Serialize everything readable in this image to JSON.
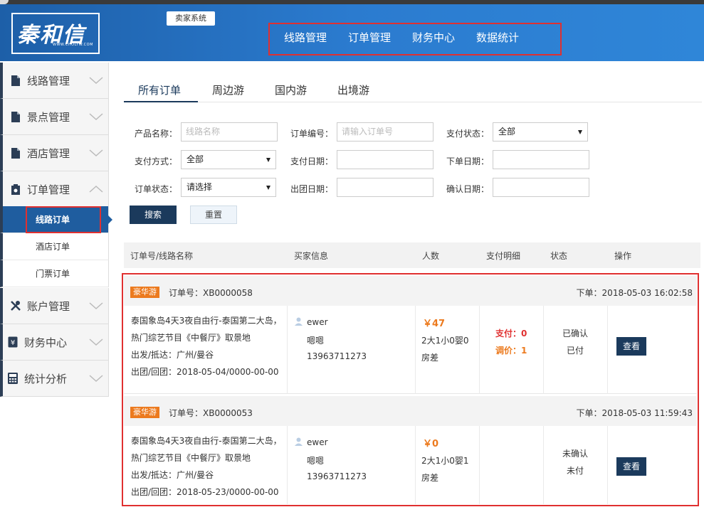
{
  "app": {
    "logo_text": "秦和信",
    "logo_url": "WWW.CHOLYW.COM",
    "system_label": "卖家系统"
  },
  "top_nav": [
    "线路管理",
    "订单管理",
    "财务中心",
    "数据统计"
  ],
  "sidebar": {
    "items": [
      {
        "label": "线路管理",
        "icon": "document-icon"
      },
      {
        "label": "景点管理",
        "icon": "document-icon"
      },
      {
        "label": "酒店管理",
        "icon": "document-icon"
      },
      {
        "label": "订单管理",
        "icon": "order-icon"
      },
      {
        "label": "账户管理",
        "icon": "tools-icon"
      },
      {
        "label": "财务中心",
        "icon": "yen-icon"
      },
      {
        "label": "统计分析",
        "icon": "calculator-icon"
      }
    ],
    "sub_items": [
      "线路订单",
      "酒店订单",
      "门票订单"
    ]
  },
  "tabs": [
    "所有订单",
    "周边游",
    "国内游",
    "出境游"
  ],
  "filters": {
    "product_name_label": "产品名称：",
    "product_name_placeholder": "线路名称",
    "order_no_label": "订单编号：",
    "order_no_placeholder": "请输入订单号",
    "pay_status_label": "支付状态：",
    "pay_status_value": "全部",
    "pay_method_label": "支付方式：",
    "pay_method_value": "全部",
    "pay_date_label": "支付日期：",
    "order_date_label": "下单日期：",
    "order_status_label": "订单状态：",
    "order_status_value": "请选择",
    "depart_date_label": "出团日期：",
    "confirm_date_label": "确认日期：",
    "search_label": "搜索",
    "reset_label": "重置"
  },
  "list_header": [
    "订单号/线路名称",
    "买家信息",
    "人数",
    "支付明细",
    "状态",
    "操作"
  ],
  "orders": [
    {
      "tag": "豪华游",
      "order_no": "订单号：XB0000058",
      "time": "下单：2018-05-03 16:02:58",
      "route_line1": "泰国象岛4天3夜自由行-泰国第二大岛，",
      "route_line2": "热门综艺节目《中餐厅》取景地",
      "route_line3": "出发/抵达：广州/曼谷",
      "route_line4": "出团/回团：2018-05-04/0000-00-00",
      "buyer_name": "ewer",
      "buyer_nick": "嗯嗯",
      "buyer_phone": "13963711273",
      "price": "￥47",
      "people": "2大1小0婴0",
      "extra": "房差",
      "pay": "支付：0",
      "adjust": "调价：1",
      "status1": "已确认",
      "status2": "已付",
      "action": "查看"
    },
    {
      "tag": "豪华游",
      "order_no": "订单号：XB0000053",
      "time": "下单：2018-05-03 11:59:43",
      "route_line1": "泰国象岛4天3夜自由行-泰国第二大岛，",
      "route_line2": "热门综艺节目《中餐厅》取景地",
      "route_line3": "出发/抵达：广州/曼谷",
      "route_line4": "出团/回团：2018-05-23/0000-00-00",
      "buyer_name": "ewer",
      "buyer_nick": "嗯嗯",
      "buyer_phone": "13963711273",
      "price": "￥0",
      "people": "2大1小0婴1",
      "extra": "房差",
      "pay": "",
      "adjust": "",
      "status1": "未确认",
      "status2": "未付",
      "action": "查看"
    }
  ],
  "colors": {
    "header_blue": "#2b7bcf",
    "navy": "#1b3a5c",
    "accent_orange": "#ec7a1e",
    "alert_red": "#e03030"
  }
}
